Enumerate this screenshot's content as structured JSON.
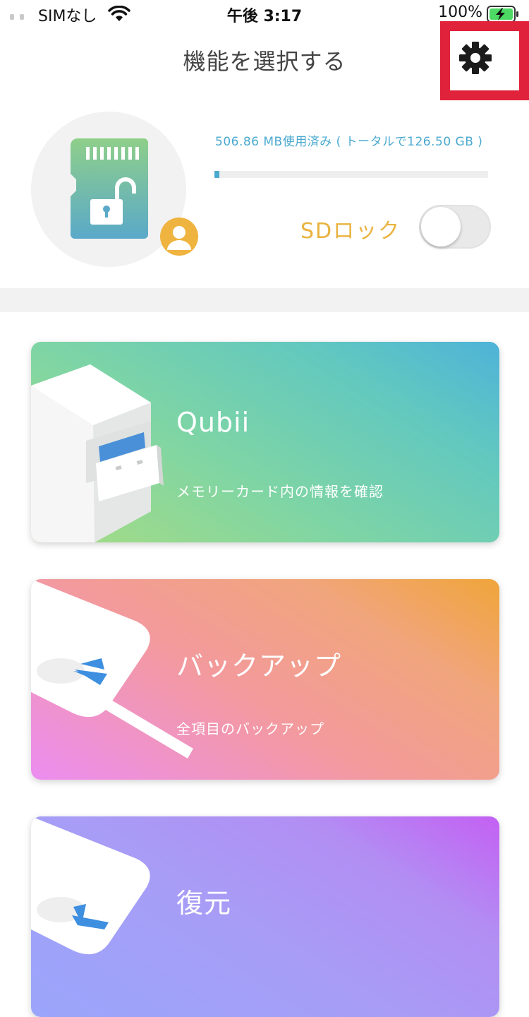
{
  "status_bar": {
    "carrier": "SIMなし",
    "time": "午後 3:17",
    "battery": "100%",
    "icons": [
      "signal-icon",
      "wifi-icon",
      "battery-charging-icon"
    ]
  },
  "header": {
    "title": "機能を選択する",
    "settings_icon": "gear-icon"
  },
  "storage": {
    "usage_text": "506.86 MB使用済み ( トータルで126.50 GB )",
    "used_fraction": 0.004,
    "sd_lock_label": "SDロック",
    "sd_lock_on": false
  },
  "cards": [
    {
      "title": "Qubii",
      "subtitle": "メモリーカード内の情報を確認"
    },
    {
      "title": "バックアップ",
      "subtitle": "全項目のバックアップ"
    },
    {
      "title": "復元",
      "subtitle": ""
    }
  ],
  "colors": {
    "accent_blue": "#4aa9cf",
    "accent_yellow": "#e9b33f",
    "highlight_red": "#e0223b"
  }
}
